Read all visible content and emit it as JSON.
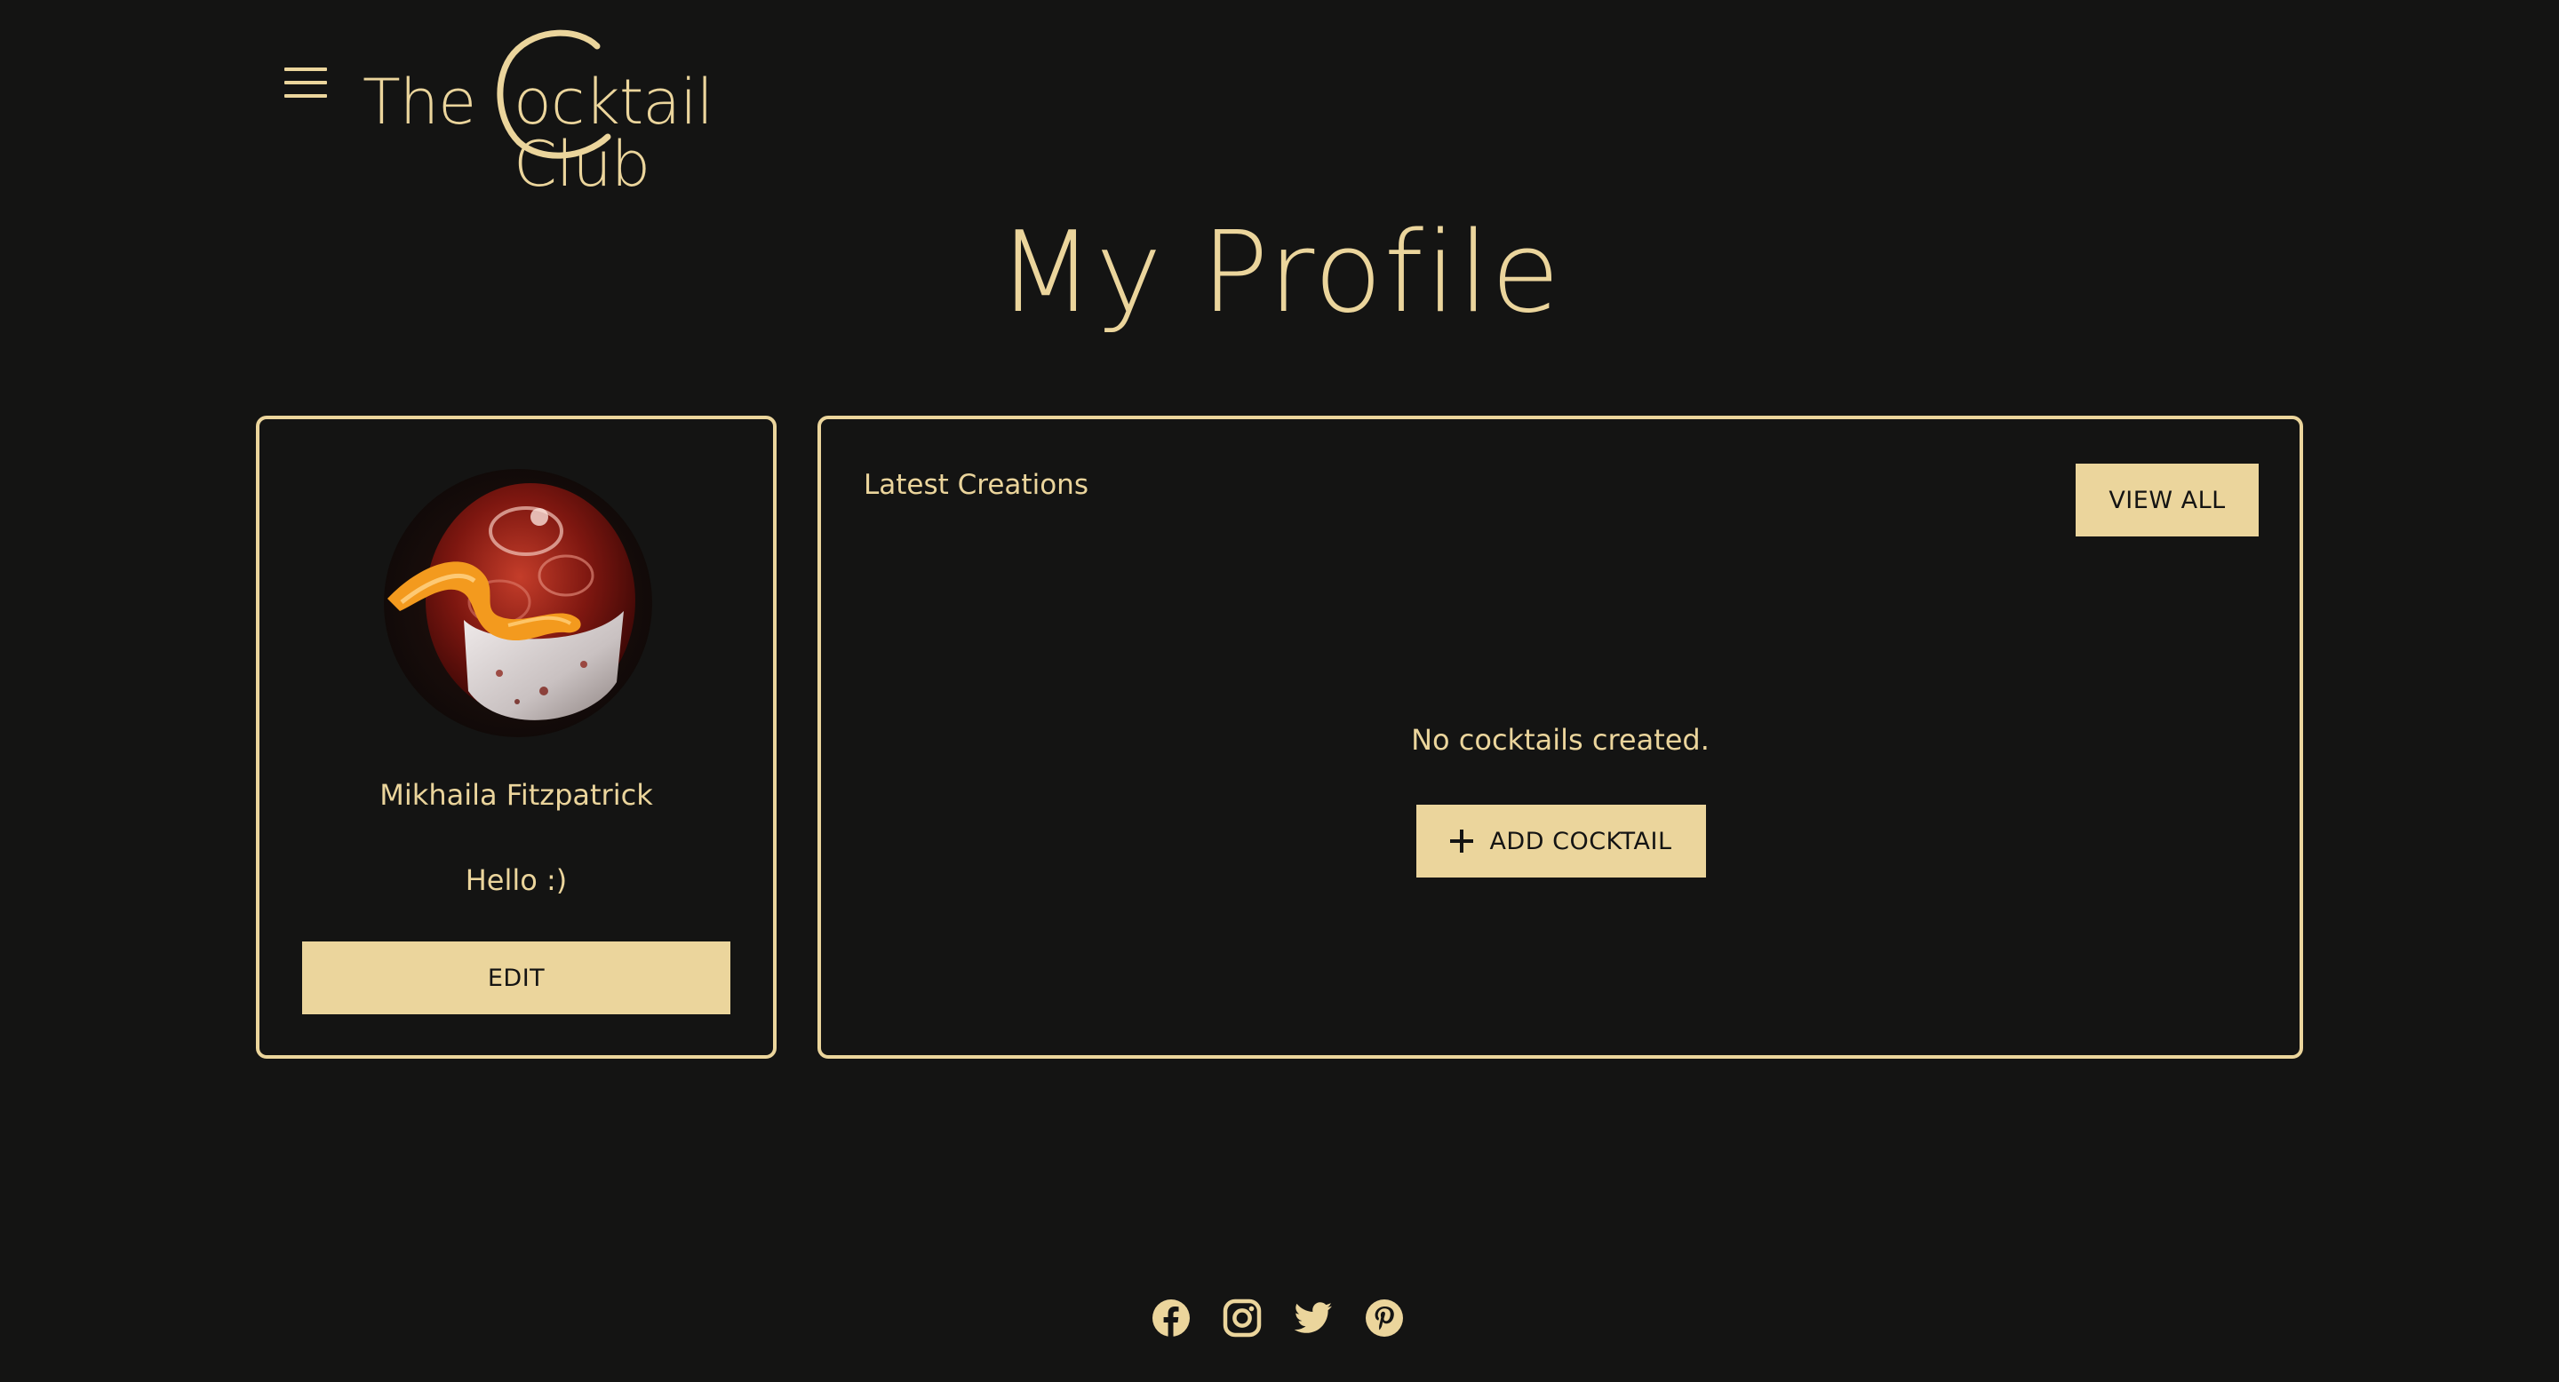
{
  "header": {
    "menu_icon": "hamburger-menu-icon",
    "logo_the": "The",
    "logo_rest": "ocktail Club",
    "logo_text": "The Cocktail Club"
  },
  "page": {
    "title": "My Profile"
  },
  "profile": {
    "avatar_icon": "cocktail-photo",
    "name": "Mikhaila Fitzpatrick",
    "bio": "Hello :)",
    "edit_label": "EDIT"
  },
  "creations": {
    "title": "Latest Creations",
    "view_all_label": "VIEW ALL",
    "empty_message": "No cocktails created.",
    "add_label": "ADD COCKTAIL"
  },
  "footer": {
    "social": [
      "facebook-icon",
      "instagram-icon",
      "twitter-icon",
      "pinterest-icon"
    ]
  },
  "colors": {
    "background": "#141413",
    "accent": "#ebd59c"
  }
}
